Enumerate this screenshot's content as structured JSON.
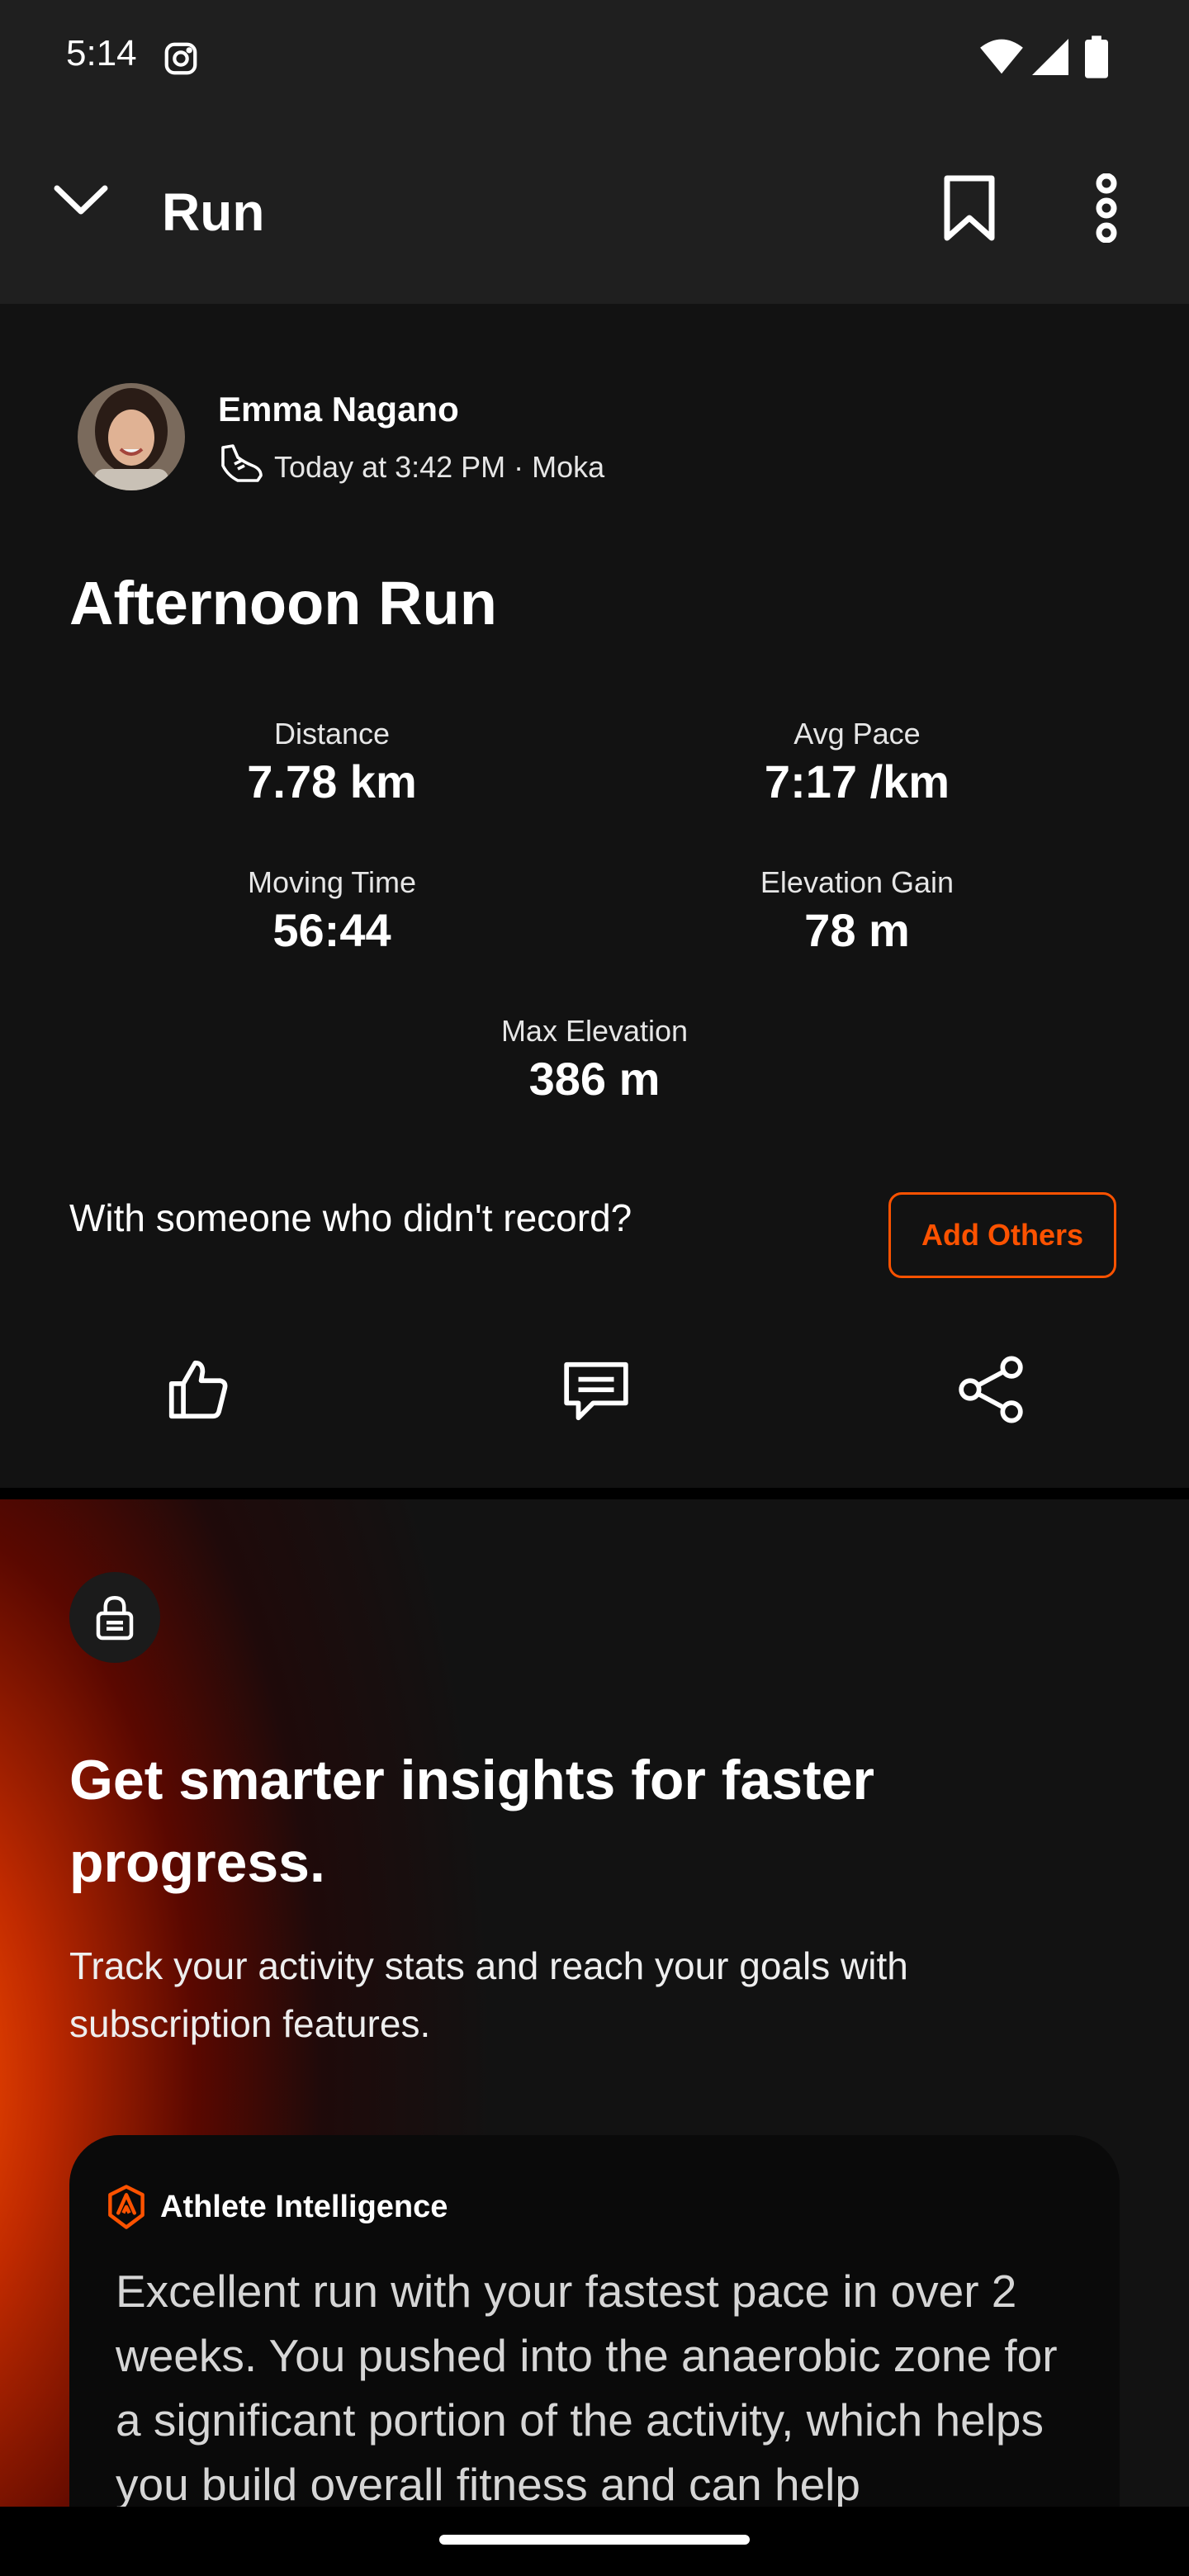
{
  "status_bar": {
    "time": "5:14"
  },
  "app_bar": {
    "title": "Run"
  },
  "activity": {
    "athlete_name": "Emma Nagano",
    "meta": "Today at 3:42 PM · Moka",
    "title": "Afternoon Run",
    "stats": [
      {
        "label": "Distance",
        "value": "7.78 km"
      },
      {
        "label": "Avg Pace",
        "value": "7:17 /km"
      },
      {
        "label": "Moving Time",
        "value": "56:44"
      },
      {
        "label": "Elevation Gain",
        "value": "78 m"
      },
      {
        "label": "Max Elevation",
        "value": "386 m"
      }
    ],
    "together_prompt": "With someone who didn't record?",
    "add_others_label": "Add Others"
  },
  "promo": {
    "headline": "Get smarter insights for faster progress.",
    "body": "Track your activity stats and reach your goals with subscription features.",
    "card_title": "Athlete Intelligence",
    "card_text": "Excellent run with your fastest pace in over 2 weeks. You pushed into the anaerobic zone for a significant portion of the activity, which helps you build overall fitness and can help"
  },
  "colors": {
    "accent": "#fc5200",
    "background": "#121212",
    "bar": "#1f1f1f"
  }
}
